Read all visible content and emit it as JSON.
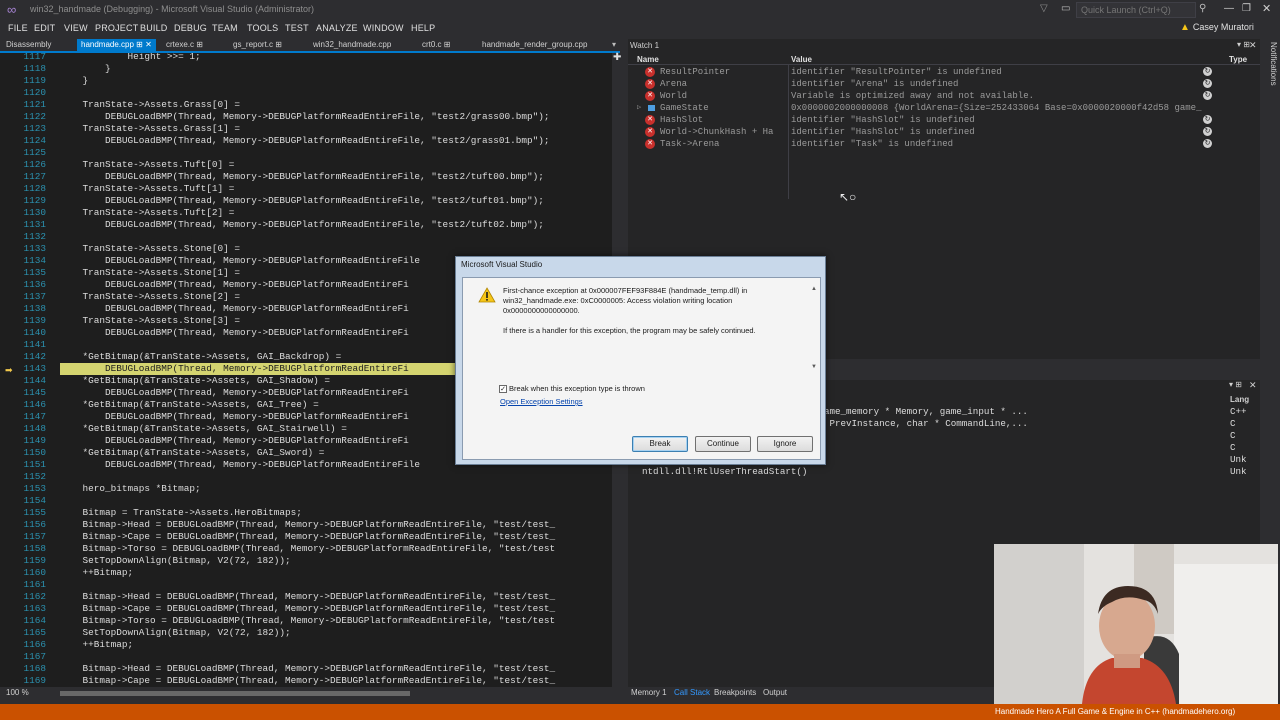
{
  "titlebar": {
    "title": "win32_handmade (Debugging) - Microsoft Visual Studio (Administrator)",
    "quick_launch_placeholder": "Quick Launch (Ctrl+Q)",
    "user_name": "Casey Muratori"
  },
  "menu": [
    "FILE",
    "EDIT",
    "VIEW",
    "PROJECT",
    "BUILD",
    "DEBUG",
    "TEAM",
    "TOOLS",
    "TEST",
    "ANALYZE",
    "WINDOW",
    "HELP"
  ],
  "tabs": [
    {
      "label": "Disassembly"
    },
    {
      "label": "handmade.cpp ⊞ ✕"
    },
    {
      "label": "crtexe.c ⊞"
    },
    {
      "label": "gs_report.c ⊞"
    },
    {
      "label": "win32_handmade.cpp"
    },
    {
      "label": "crt0.c ⊞"
    },
    {
      "label": "handmade_render_group.cpp"
    }
  ],
  "editor": {
    "zoom": "100 %",
    "current_line": "1143",
    "lines": [
      {
        "n": "1117",
        "code": "            Height >>= 1;"
      },
      {
        "n": "1118",
        "code": "        }"
      },
      {
        "n": "1119",
        "code": "    }"
      },
      {
        "n": "1120",
        "code": ""
      },
      {
        "n": "1121",
        "code": "    TranState->Assets.Grass[0] ="
      },
      {
        "n": "1122",
        "code": "        DEBUGLoadBMP(Thread, Memory->DEBUGPlatformReadEntireFile, \"test2/grass00.bmp\");"
      },
      {
        "n": "1123",
        "code": "    TranState->Assets.Grass[1] ="
      },
      {
        "n": "1124",
        "code": "        DEBUGLoadBMP(Thread, Memory->DEBUGPlatformReadEntireFile, \"test2/grass01.bmp\");"
      },
      {
        "n": "1125",
        "code": ""
      },
      {
        "n": "1126",
        "code": "    TranState->Assets.Tuft[0] ="
      },
      {
        "n": "1127",
        "code": "        DEBUGLoadBMP(Thread, Memory->DEBUGPlatformReadEntireFile, \"test2/tuft00.bmp\");"
      },
      {
        "n": "1128",
        "code": "    TranState->Assets.Tuft[1] ="
      },
      {
        "n": "1129",
        "code": "        DEBUGLoadBMP(Thread, Memory->DEBUGPlatformReadEntireFile, \"test2/tuft01.bmp\");"
      },
      {
        "n": "1130",
        "code": "    TranState->Assets.Tuft[2] ="
      },
      {
        "n": "1131",
        "code": "        DEBUGLoadBMP(Thread, Memory->DEBUGPlatformReadEntireFile, \"test2/tuft02.bmp\");"
      },
      {
        "n": "1132",
        "code": ""
      },
      {
        "n": "1133",
        "code": "    TranState->Assets.Stone[0] ="
      },
      {
        "n": "1134",
        "code": "        DEBUGLoadBMP(Thread, Memory->DEBUGPlatformReadEntireFile"
      },
      {
        "n": "1135",
        "code": "    TranState->Assets.Stone[1] ="
      },
      {
        "n": "1136",
        "code": "        DEBUGLoadBMP(Thread, Memory->DEBUGPlatformReadEntireFi"
      },
      {
        "n": "1137",
        "code": "    TranState->Assets.Stone[2] ="
      },
      {
        "n": "1138",
        "code": "        DEBUGLoadBMP(Thread, Memory->DEBUGPlatformReadEntireFi"
      },
      {
        "n": "1139",
        "code": "    TranState->Assets.Stone[3] ="
      },
      {
        "n": "1140",
        "code": "        DEBUGLoadBMP(Thread, Memory->DEBUGPlatformReadEntireFi"
      },
      {
        "n": "1141",
        "code": ""
      },
      {
        "n": "1142",
        "code": "    *GetBitmap(&TranState->Assets, GAI_Backdrop) ="
      },
      {
        "n": "1143",
        "code": "        DEBUGLoadBMP(Thread, Memory->DEBUGPlatformReadEntireFi"
      },
      {
        "n": "1144",
        "code": "    *GetBitmap(&TranState->Assets, GAI_Shadow) ="
      },
      {
        "n": "1145",
        "code": "        DEBUGLoadBMP(Thread, Memory->DEBUGPlatformReadEntireFi"
      },
      {
        "n": "1146",
        "code": "    *GetBitmap(&TranState->Assets, GAI_Tree) ="
      },
      {
        "n": "1147",
        "code": "        DEBUGLoadBMP(Thread, Memory->DEBUGPlatformReadEntireFi"
      },
      {
        "n": "1148",
        "code": "    *GetBitmap(&TranState->Assets, GAI_Stairwell) ="
      },
      {
        "n": "1149",
        "code": "        DEBUGLoadBMP(Thread, Memory->DEBUGPlatformReadEntireFi"
      },
      {
        "n": "1150",
        "code": "    *GetBitmap(&TranState->Assets, GAI_Sword) ="
      },
      {
        "n": "1151",
        "code": "        DEBUGLoadBMP(Thread, Memory->DEBUGPlatformReadEntireFile"
      },
      {
        "n": "1152",
        "code": ""
      },
      {
        "n": "1153",
        "code": "    hero_bitmaps *Bitmap;"
      },
      {
        "n": "1154",
        "code": ""
      },
      {
        "n": "1155",
        "code": "    Bitmap = TranState->Assets.HeroBitmaps;"
      },
      {
        "n": "1156",
        "code": "    Bitmap->Head = DEBUGLoadBMP(Thread, Memory->DEBUGPlatformReadEntireFile, \"test/test_"
      },
      {
        "n": "1157",
        "code": "    Bitmap->Cape = DEBUGLoadBMP(Thread, Memory->DEBUGPlatformReadEntireFile, \"test/test_"
      },
      {
        "n": "1158",
        "code": "    Bitmap->Torso = DEBUGLoadBMP(Thread, Memory->DEBUGPlatformReadEntireFile, \"test/test"
      },
      {
        "n": "1159",
        "code": "    SetTopDownAlign(Bitmap, V2(72, 182));"
      },
      {
        "n": "1160",
        "code": "    ++Bitmap;"
      },
      {
        "n": "1161",
        "code": ""
      },
      {
        "n": "1162",
        "code": "    Bitmap->Head = DEBUGLoadBMP(Thread, Memory->DEBUGPlatformReadEntireFile, \"test/test_"
      },
      {
        "n": "1163",
        "code": "    Bitmap->Cape = DEBUGLoadBMP(Thread, Memory->DEBUGPlatformReadEntireFile, \"test/test_"
      },
      {
        "n": "1164",
        "code": "    Bitmap->Torso = DEBUGLoadBMP(Thread, Memory->DEBUGPlatformReadEntireFile, \"test/test"
      },
      {
        "n": "1165",
        "code": "    SetTopDownAlign(Bitmap, V2(72, 182));"
      },
      {
        "n": "1166",
        "code": "    ++Bitmap;"
      },
      {
        "n": "1167",
        "code": ""
      },
      {
        "n": "1168",
        "code": "    Bitmap->Head = DEBUGLoadBMP(Thread, Memory->DEBUGPlatformReadEntireFile, \"test/test_"
      },
      {
        "n": "1169",
        "code": "    Bitmap->Cape = DEBUGLoadBMP(Thread, Memory->DEBUGPlatformReadEntireFile, \"test/test_"
      }
    ]
  },
  "watch": {
    "title": "Watch 1",
    "col_name": "Name",
    "col_value": "Value",
    "col_type": "Type",
    "rows": [
      {
        "name": "ResultPointer",
        "value": "identifier \"ResultPointer\" is undefined",
        "kind": "error"
      },
      {
        "name": "Arena",
        "value": "identifier \"Arena\" is undefined",
        "kind": "error"
      },
      {
        "name": "World",
        "value": "Variable is optimized away and not available.",
        "kind": "error"
      },
      {
        "name": "GameState",
        "value": "0x0000002000000008 {WorldArena={Size=252433064 Base=0x0000020000f42d58 game_",
        "kind": "object"
      },
      {
        "name": "HashSlot",
        "value": "identifier \"HashSlot\" is undefined",
        "kind": "error"
      },
      {
        "name": "World->ChunkHash + Ha",
        "value": "identifier \"HashSlot\" is undefined",
        "kind": "error"
      },
      {
        "name": "Task->Arena",
        "value": "identifier \"Task\" is undefined",
        "kind": "error"
      }
    ]
  },
  "notifications_tab": "Notifications",
  "callstack": {
    "col_lang": "Lang",
    "rows": [
      {
        "name": "Render(thread_context * Thread, game_memory * Memory, game_input * ...",
        "lang": "C++"
      },
      {
        "name": "TANCE__ * Instance, HINSTANCE__ * PrevInstance, char * CommandLine,...",
        "lang": "C"
      },
      {
        "name": "artup() Line 251",
        "lang": "C"
      },
      {
        "name": "artup() Line 165",
        "lang": "C"
      },
      {
        "name": "k()",
        "lang": "Unk"
      },
      {
        "name": "ntdll.dll!RtlUserThreadStart()",
        "lang": "Unk"
      }
    ]
  },
  "bottom_tabs": [
    "Memory 1",
    "Call Stack",
    "Breakpoints",
    "Output"
  ],
  "dialog": {
    "title": "Microsoft Visual Studio",
    "message": "First-chance exception at 0x000007FEF93F884E (handmade_temp.dll) in win32_handmade.exe: 0xC0000005: Access violation writing location 0x0000000000000000.",
    "hint": "If there is a handler for this exception, the program may be safely continued.",
    "checkbox_label": "Break when this exception type is thrown",
    "link": "Open Exception Settings",
    "buttons": {
      "break": "Break",
      "continue": "Continue",
      "ignore": "Ignore"
    }
  },
  "stream_overlay": "Handmade Hero   A Full Game & Engine in C++   (handmadehero.org)",
  "colors": {
    "accent": "#007acc",
    "status_bar": "#ca5100",
    "highlight_line": "#d4d470"
  }
}
